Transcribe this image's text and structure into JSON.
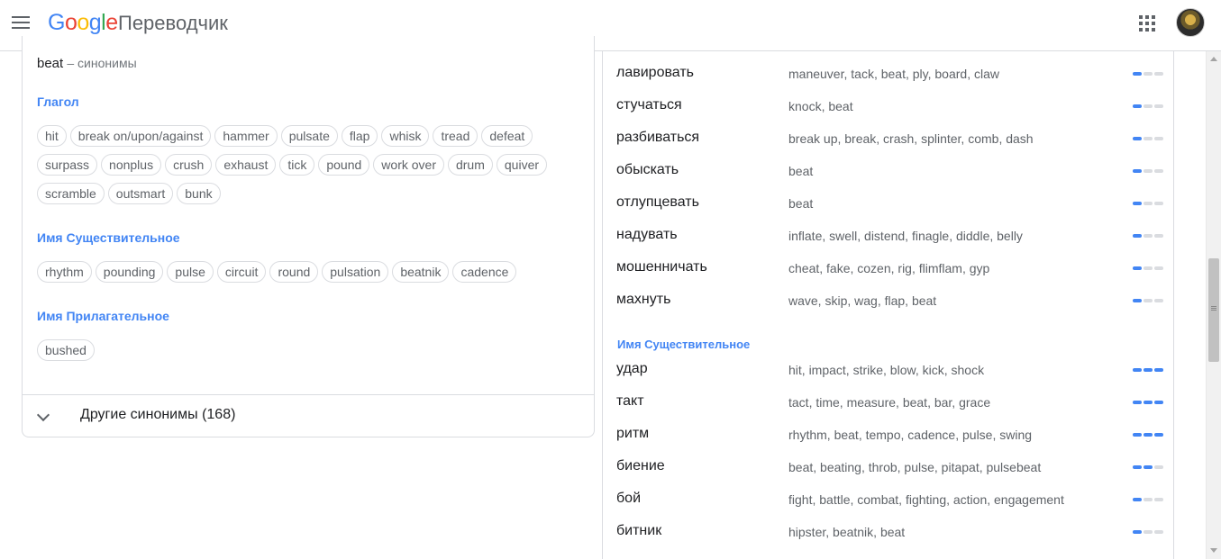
{
  "header": {
    "logo_letters": [
      "G",
      "o",
      "o",
      "g",
      "l",
      "e"
    ],
    "product": "Переводчик",
    "apps_icon": "apps-grid-icon",
    "menu_icon": "hamburger-menu-icon"
  },
  "synonyms": {
    "word": "beat",
    "subtitle": "– синонимы",
    "groups": [
      {
        "pos": "Глагол",
        "chips": [
          "hit",
          "break on/upon/against",
          "hammer",
          "pulsate",
          "flap",
          "whisk",
          "tread",
          "defeat",
          "surpass",
          "nonplus",
          "crush",
          "exhaust",
          "tick",
          "pound",
          "work over",
          "drum",
          "quiver",
          "scramble",
          "outsmart",
          "bunk"
        ]
      },
      {
        "pos": "Имя Существительное",
        "chips": [
          "rhythm",
          "pounding",
          "pulse",
          "circuit",
          "round",
          "pulsation",
          "beatnik",
          "cadence"
        ]
      },
      {
        "pos": "Имя Прилагательное",
        "chips": [
          "bushed"
        ]
      }
    ],
    "more_label": "Другие синонимы (168)"
  },
  "translations": {
    "verb_rows": [
      {
        "word": "лавировать",
        "syns": "maneuver, tack, beat, ply, board, claw",
        "freq": 1
      },
      {
        "word": "стучаться",
        "syns": "knock, beat",
        "freq": 1
      },
      {
        "word": "разбиваться",
        "syns": "break up, break, crash, splinter, comb, dash",
        "freq": 1
      },
      {
        "word": "обыскать",
        "syns": "beat",
        "freq": 1
      },
      {
        "word": "отлупцевать",
        "syns": "beat",
        "freq": 1
      },
      {
        "word": "надувать",
        "syns": "inflate, swell, distend, finagle, diddle, belly",
        "freq": 1
      },
      {
        "word": "мошенничать",
        "syns": "cheat, fake, cozen, rig, flimflam, gyp",
        "freq": 1
      },
      {
        "word": "махнуть",
        "syns": "wave, skip, wag, flap, beat",
        "freq": 1
      }
    ],
    "noun_label": "Имя Существительное",
    "noun_rows": [
      {
        "word": "удар",
        "syns": "hit, impact, strike, blow, kick, shock",
        "freq": 3
      },
      {
        "word": "такт",
        "syns": "tact, time, measure, beat, bar, grace",
        "freq": 3
      },
      {
        "word": "ритм",
        "syns": "rhythm, beat, tempo, cadence, pulse, swing",
        "freq": 3
      },
      {
        "word": "биение",
        "syns": "beat, beating, throb, pulse, pitapat, pulsebeat",
        "freq": 2
      },
      {
        "word": "бой",
        "syns": "fight, battle, combat, fighting, action, engagement",
        "freq": 1
      },
      {
        "word": "битник",
        "syns": "hipster, beatnik, beat",
        "freq": 1
      }
    ]
  },
  "colors": {
    "accent": "#4285f4",
    "border": "#dadce0",
    "muted": "#5f6368"
  }
}
